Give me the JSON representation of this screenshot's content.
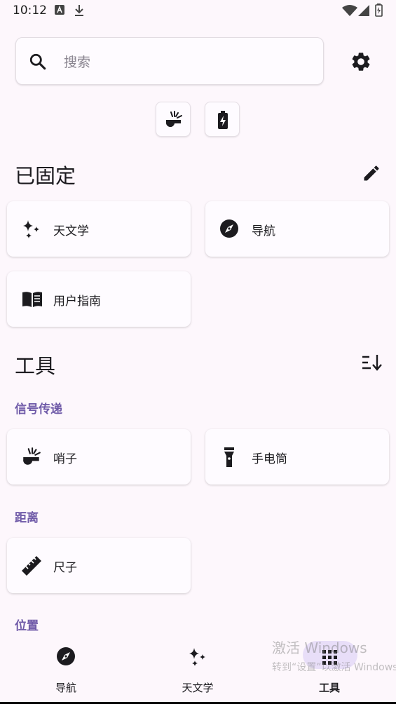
{
  "status_bar": {
    "time": "10:12"
  },
  "search": {
    "placeholder": "搜索"
  },
  "pinned": {
    "title": "已固定",
    "items": [
      {
        "label": "天文学",
        "icon": "sparkles-icon"
      },
      {
        "label": "导航",
        "icon": "compass-icon"
      },
      {
        "label": "用户指南",
        "icon": "book-icon"
      }
    ]
  },
  "tools": {
    "title": "工具",
    "categories": [
      {
        "title": "信号传递",
        "items": [
          {
            "label": "哨子",
            "icon": "whistle-icon"
          },
          {
            "label": "手电筒",
            "icon": "flashlight-icon"
          }
        ]
      },
      {
        "title": "距离",
        "items": [
          {
            "label": "尺子",
            "icon": "ruler-icon"
          }
        ]
      },
      {
        "title": "位置",
        "items": []
      }
    ]
  },
  "bottom_nav": {
    "items": [
      {
        "label": "导航",
        "icon": "compass-icon"
      },
      {
        "label": "天文学",
        "icon": "sparkles-icon"
      },
      {
        "label": "工具",
        "icon": "grid-icon",
        "active": true
      }
    ]
  },
  "watermark": {
    "line1": "激活 Windows",
    "line2": "转到“设置”以激活 Windows。"
  },
  "colors": {
    "background": "#fdf7fc",
    "accent": "#6f5aa8",
    "active_pill": "#e8def8"
  }
}
